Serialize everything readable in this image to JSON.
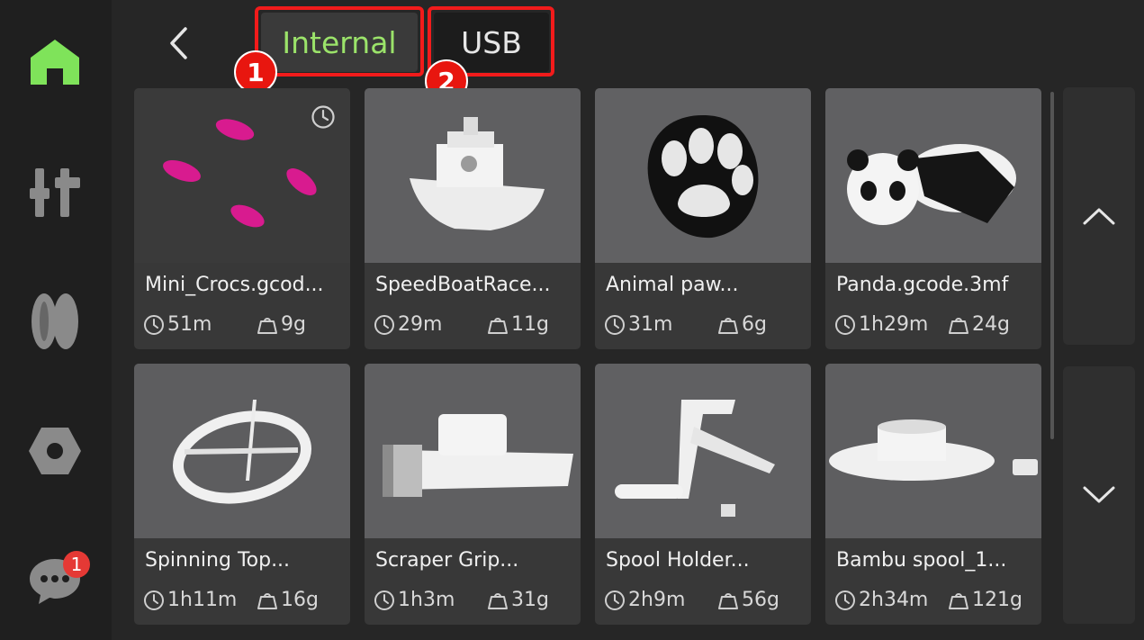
{
  "sidebar": {
    "items": [
      {
        "icon": "home-icon"
      },
      {
        "icon": "controls-icon"
      },
      {
        "icon": "filament-icon"
      },
      {
        "icon": "settings-icon"
      },
      {
        "icon": "chat-icon",
        "badge": "1"
      }
    ]
  },
  "header": {
    "back_icon": "chevron-left-icon",
    "tabs": [
      {
        "label": "Internal",
        "marker": "1"
      },
      {
        "label": "USB",
        "marker": "2"
      }
    ]
  },
  "files": [
    {
      "name": "Mini_Crocs.gcod...",
      "time": "51m",
      "weight": "9g"
    },
    {
      "name": "SpeedBoatRace...",
      "time": "29m",
      "weight": "11g"
    },
    {
      "name": "Animal paw...",
      "time": "31m",
      "weight": "6g"
    },
    {
      "name": "Panda.gcode.3mf",
      "time": "1h29m",
      "weight": "24g"
    },
    {
      "name": "Spinning Top...",
      "time": "1h11m",
      "weight": "16g"
    },
    {
      "name": "Scraper Grip...",
      "time": "1h3m",
      "weight": "31g"
    },
    {
      "name": "Spool Holder...",
      "time": "2h9m",
      "weight": "56g"
    },
    {
      "name": "Bambu spool_1...",
      "time": "2h34m",
      "weight": "121g"
    }
  ],
  "pager": {
    "up_icon": "chevron-up-icon",
    "down_icon": "chevron-down-icon"
  },
  "colors": {
    "accent": "#9be36a",
    "highlight": "#f21b1b",
    "badge": "#e53935"
  }
}
